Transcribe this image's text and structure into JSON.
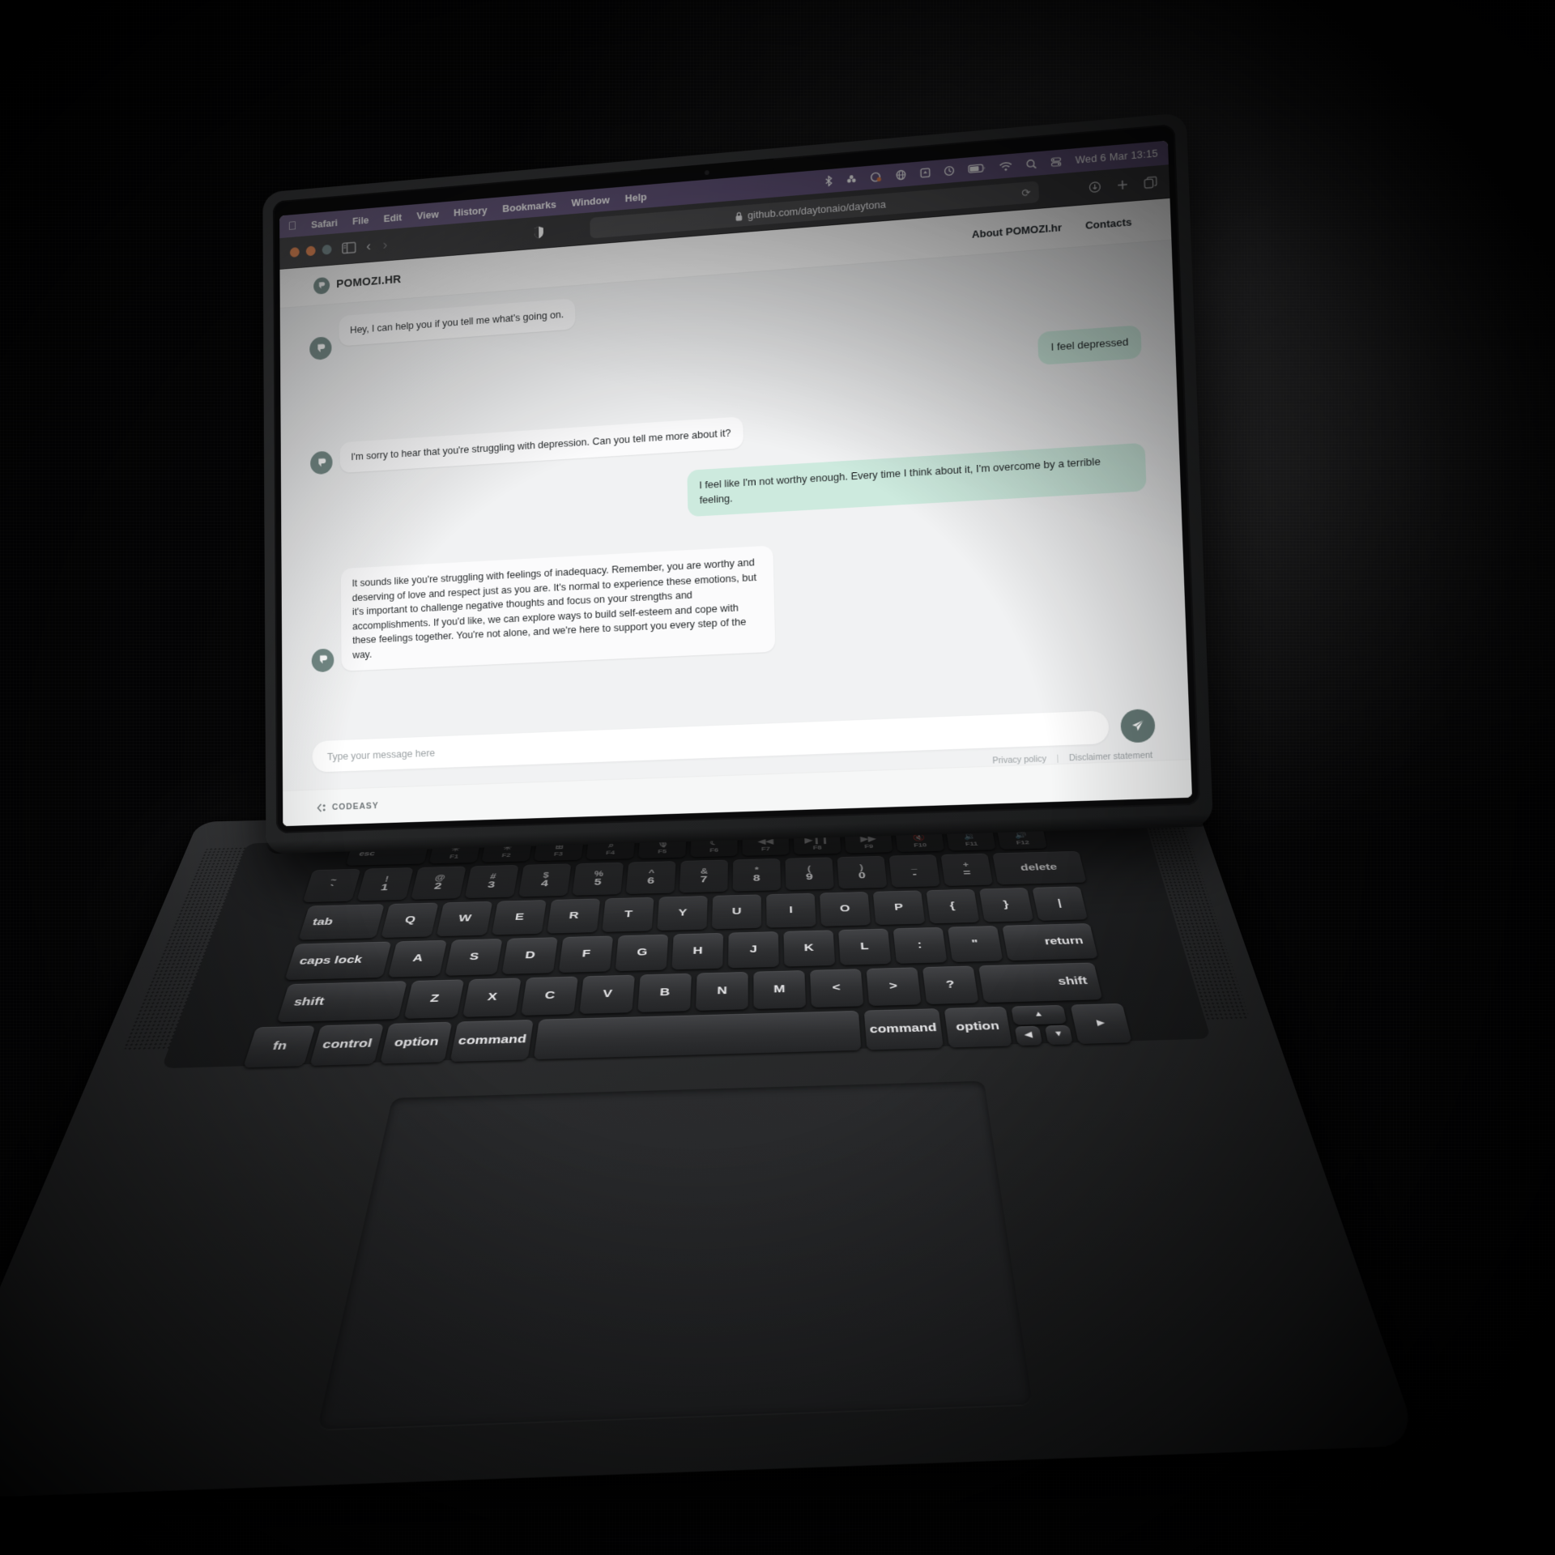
{
  "menubar": {
    "apple_icon": "apple-icon",
    "items": [
      "Safari",
      "File",
      "Edit",
      "View",
      "History",
      "Bookmarks",
      "Window",
      "Help"
    ],
    "status_icons": [
      "bluetooth-icon",
      "dropbox-icon",
      "screenshot-icon",
      "vpn-icon",
      "display-icon",
      "timemachine-icon",
      "battery-icon",
      "wifi-icon",
      "search-icon",
      "controlcenter-icon"
    ],
    "clock": "Wed 6 Mar  13:15"
  },
  "toolbar": {
    "sidebar_icon": "sidebar-icon",
    "back_icon": "chevron-left-icon",
    "forward_icon": "chevron-right-icon",
    "shield_icon": "shield-icon",
    "lock_icon": "lock-icon",
    "url": "github.com/daytonaio/daytona",
    "reload_icon": "reload-icon",
    "download_icon": "download-icon",
    "newtab_icon": "plus-icon",
    "tabs_icon": "tab-overview-icon"
  },
  "site": {
    "brand": "POMOZI.HR",
    "brand_mark_icon": "pomozi-chat-logo-icon",
    "nav": [
      {
        "label": "About POMOZI.hr"
      },
      {
        "label": "Contacts"
      }
    ]
  },
  "chat": {
    "messages": [
      {
        "from": "bot",
        "text": "Hey, I can help you if you tell me what's going on."
      },
      {
        "from": "user",
        "text": "I feel depressed"
      },
      {
        "from": "bot",
        "text": "I'm sorry to hear that you're struggling with depression. Can you tell me more about it?"
      },
      {
        "from": "user",
        "text": "I feel like I'm not worthy enough. Every time I think about it, I'm overcome by a terrible feeling."
      },
      {
        "from": "bot",
        "text": "It sounds like you're struggling with feelings of inadequacy. Remember, you are worthy and deserving of love and respect just as you are. It's normal to experience these emotions, but it's important to challenge negative thoughts and focus on your strengths and accomplishments. If you'd like, we can explore ways to build self-esteem and cope with these feelings together. You're not alone, and we're here to support you every step of the way."
      }
    ],
    "input_placeholder": "Type your message here",
    "input_value": "",
    "send_icon": "send-paper-plane-icon"
  },
  "legal": {
    "privacy": "Privacy policy",
    "separator": "|",
    "disclaimer": "Disclaimer statement"
  },
  "footer": {
    "logo_icon": "codeasy-mark-icon",
    "logo_text": "CODEASY"
  },
  "colors": {
    "menubar_purple": "#615279",
    "bot_bubble": "#fbfbfc",
    "user_bubble": "#cdeade",
    "accent_green": "#6d8480",
    "send_button": "#667a77",
    "page_bg": "#f1f2f3"
  },
  "keyboard": {
    "fn_row": [
      {
        "label": "esc"
      },
      {
        "glyph": "brightness-down-icon",
        "sub": "F1"
      },
      {
        "glyph": "brightness-up-icon",
        "sub": "F2"
      },
      {
        "glyph": "mission-control-icon",
        "sub": "F3"
      },
      {
        "glyph": "spotlight-icon",
        "sub": "F4"
      },
      {
        "glyph": "dictation-icon",
        "sub": "F5"
      },
      {
        "glyph": "do-not-disturb-icon",
        "sub": "F6"
      },
      {
        "glyph": "rewind-icon",
        "sub": "F7"
      },
      {
        "glyph": "play-pause-icon",
        "sub": "F8"
      },
      {
        "glyph": "fast-forward-icon",
        "sub": "F9"
      },
      {
        "glyph": "mute-icon",
        "sub": "F10"
      },
      {
        "glyph": "volume-down-icon",
        "sub": "F11"
      },
      {
        "glyph": "volume-up-icon",
        "sub": "F12"
      }
    ],
    "row1": [
      {
        "top": "~",
        "main": "`"
      },
      {
        "top": "!",
        "main": "1"
      },
      {
        "top": "@",
        "main": "2"
      },
      {
        "top": "#",
        "main": "3"
      },
      {
        "top": "$",
        "main": "4"
      },
      {
        "top": "%",
        "main": "5"
      },
      {
        "top": "^",
        "main": "6"
      },
      {
        "top": "&",
        "main": "7"
      },
      {
        "top": "*",
        "main": "8"
      },
      {
        "top": "(",
        "main": "9"
      },
      {
        "top": ")",
        "main": "0"
      },
      {
        "top": "_",
        "main": "-"
      },
      {
        "top": "+",
        "main": "="
      },
      {
        "main": "delete"
      }
    ],
    "row2": [
      "tab",
      "Q",
      "W",
      "E",
      "R",
      "T",
      "Y",
      "U",
      "I",
      "O",
      "P",
      "{",
      "}",
      "|"
    ],
    "row3": [
      "caps lock",
      "A",
      "S",
      "D",
      "F",
      "G",
      "H",
      "J",
      "K",
      "L",
      ":",
      "\"",
      "return"
    ],
    "row4": [
      "shift",
      "Z",
      "X",
      "C",
      "V",
      "B",
      "N",
      "M",
      "<",
      ">",
      "?",
      "shift"
    ],
    "row5": [
      "fn",
      "control",
      "option",
      "command",
      "command",
      "option"
    ]
  }
}
